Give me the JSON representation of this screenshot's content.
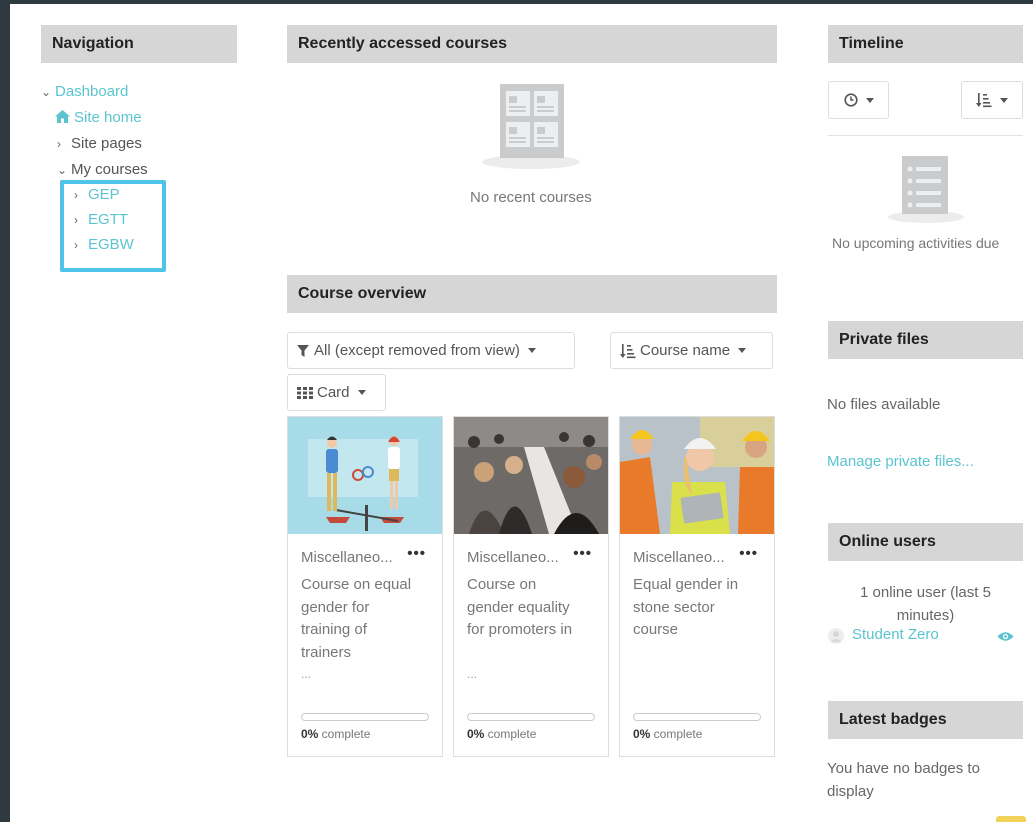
{
  "navigation": {
    "title": "Navigation",
    "dashboard": "Dashboard",
    "site_home": "Site home",
    "site_pages": "Site pages",
    "my_courses": "My courses",
    "courses": [
      "GEP",
      "EGTT",
      "EGBW"
    ],
    "highlight_color": "#4fc3e8"
  },
  "recent": {
    "title": "Recently accessed courses",
    "empty": "No recent courses"
  },
  "overview": {
    "title": "Course overview",
    "filter": "All (except removed from view)",
    "sort": "Course name",
    "view": "Card",
    "cards": [
      {
        "category": "Miscellaneo...",
        "title": "Course on equal gender for training of trainers",
        "more": "...",
        "progress": 0,
        "pct_num": "0%",
        "pct_text": " complete"
      },
      {
        "category": "Miscellaneo...",
        "title": "Course on gender equality for promoters in",
        "more": "...",
        "progress": 0,
        "pct_num": "0%",
        "pct_text": " complete"
      },
      {
        "category": "Miscellaneo...",
        "title": "Equal gender in stone sector course",
        "more": "",
        "progress": 0,
        "pct_num": "0%",
        "pct_text": " complete"
      }
    ]
  },
  "timeline": {
    "title": "Timeline",
    "empty": "No upcoming activities due"
  },
  "private_files": {
    "title": "Private files",
    "empty": "No files available",
    "manage": "Manage private files..."
  },
  "online_users": {
    "title": "Online users",
    "summary_line1": "1 online user (last 5",
    "summary_line2": "minutes)",
    "user": "Student Zero"
  },
  "badges": {
    "title": "Latest badges",
    "empty_line1": "You have no badges to",
    "empty_line2": "display"
  },
  "colors": {
    "link": "#5bc4cf",
    "header_bg": "#d6d6d6",
    "frame": "#2e3a3f"
  }
}
